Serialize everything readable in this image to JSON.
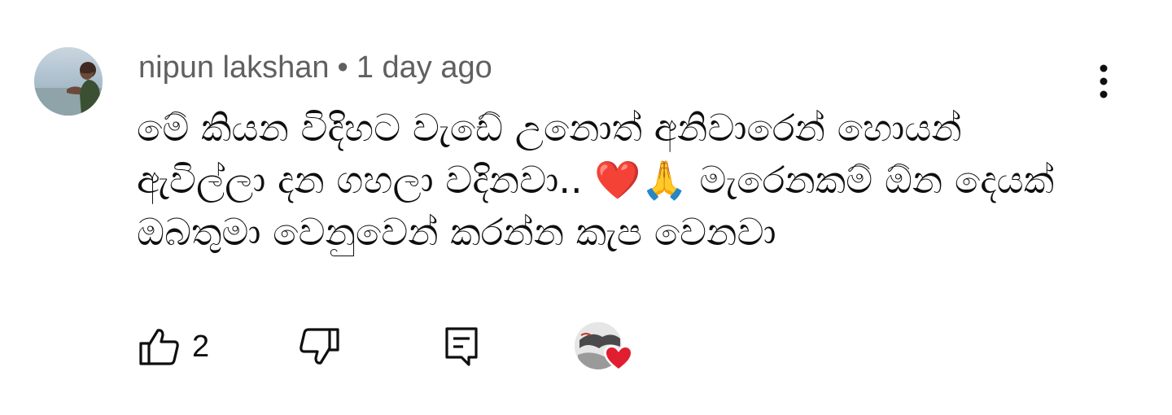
{
  "comment": {
    "author": "nipun lakshan",
    "separator": "•",
    "timestamp": "1 day ago",
    "text": "මේ කියන විදිහට වැඩේ උනොත් අනිවාරෙන් හොයන් ඇවිල්ලා දන ගහලා වදිනවා.. ❤️🙏 මැරෙනකම් ඕන දෙයක් ඔබතුමා වෙනුවෙන් කරන්න කැප වෙනවා",
    "like_count": "2"
  },
  "icons": {
    "avatar": "user-avatar-image",
    "menu": "more-vert-icon",
    "like": "thumb-up-icon",
    "dislike": "thumb-down-icon",
    "reply": "reply-comment-icon",
    "creator_heart": "creator-heart-icon"
  },
  "colors": {
    "meta_text": "#606060",
    "body_text": "#0f0f0f",
    "heart": "#e01e2f"
  }
}
